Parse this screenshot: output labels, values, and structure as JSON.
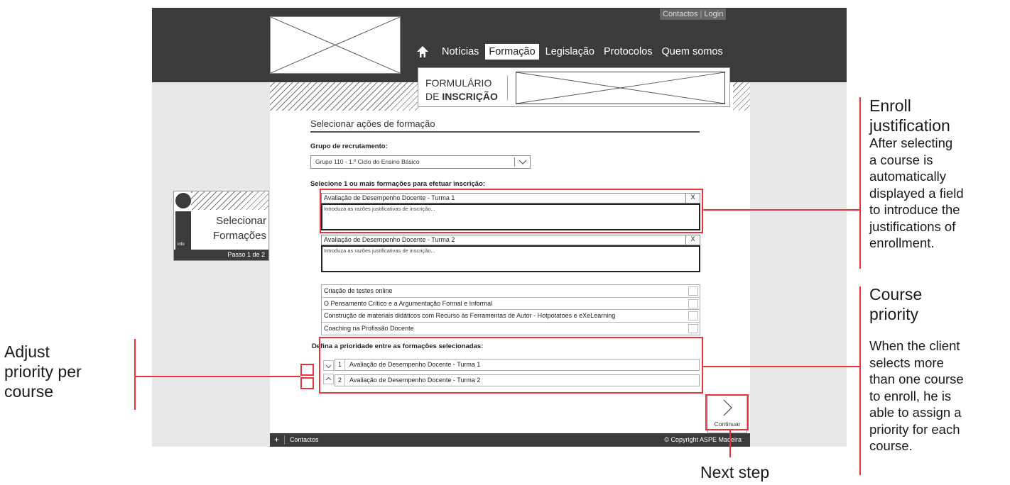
{
  "header": {
    "toplinks": {
      "contact": "Contactos",
      "login": "Login"
    },
    "nav": [
      {
        "label": "Notícias",
        "active": false
      },
      {
        "label": "Formação",
        "active": true
      },
      {
        "label": "Legislação",
        "active": false
      },
      {
        "label": "Protocolos",
        "active": false
      },
      {
        "label": "Quem somos",
        "active": false
      }
    ],
    "home_icon": "home-icon"
  },
  "form_tab": {
    "line1": "FORMULÁRIO",
    "line2_prefix": "DE",
    "line2_bold": "INSCRIÇÃO"
  },
  "info_panel": {
    "icon_label": "info",
    "title_line1": "Selecionar",
    "title_line2": "Formações",
    "step": "Passo 1 de 2"
  },
  "main": {
    "section_title": "Selecionar ações de formação",
    "recruitment_label": "Grupo de recrutamento:",
    "recruitment_value": "Grupo 110 - 1.º Ciclo do Ensino Básico",
    "select_label": "Selecione 1 ou mais formações para efetuar inscrição:",
    "selected_courses": [
      {
        "name": "Avaliação de Desempenho Docente - Turma 1",
        "remove": "X",
        "placeholder": "Introduza as razões justificativas de inscrição..."
      },
      {
        "name": "Avaliação de Desempenho Docente - Turma 2",
        "remove": "X",
        "placeholder": "Introduza as razões justificativas de inscrição..."
      }
    ],
    "available_courses": [
      "Criação de testes online",
      "O Pensamento Crítico e a Argumentação Formal e Informal",
      "Construção de materiais didáticos com Recurso às Ferramentas de Autor - Hotpotatoes e eXeLearning",
      "Coaching na Profissão Docente"
    ],
    "priority_label": "Defina a prioridade entre as formações selecionadas:",
    "priority": [
      {
        "num": "1",
        "name": "Avaliação de Desempenho Docente - Turma 1"
      },
      {
        "num": "2",
        "name": "Avaliação de Desempenho Docente - Turma 2"
      }
    ],
    "continue_label": "Continuar"
  },
  "footer": {
    "plus": "+",
    "contact": "Contactos",
    "copyright": "© Copyright ASPE Madeira"
  },
  "annotations": {
    "enroll": {
      "title_line1": "Enroll",
      "title_line2": "justification",
      "lines": [
        "After selecting",
        "a course is",
        "automatically",
        "displayed a field",
        "to introduce the",
        "justifications of",
        "enrollment."
      ]
    },
    "priority": {
      "title_line1": "Course",
      "title_line2": "priority",
      "lines": [
        "When the client",
        "selects more",
        "than one course",
        "to enroll, he is",
        "able to assign a",
        "priority for each",
        "course."
      ]
    },
    "adjust": {
      "lines": [
        "Adjust",
        "priority per",
        "course"
      ]
    },
    "next": {
      "label": "Next step"
    }
  },
  "colors": {
    "dark_bar": "#3b3b3b",
    "annotation_red": "#e8323c",
    "page_bg": "#e8e8e8"
  }
}
